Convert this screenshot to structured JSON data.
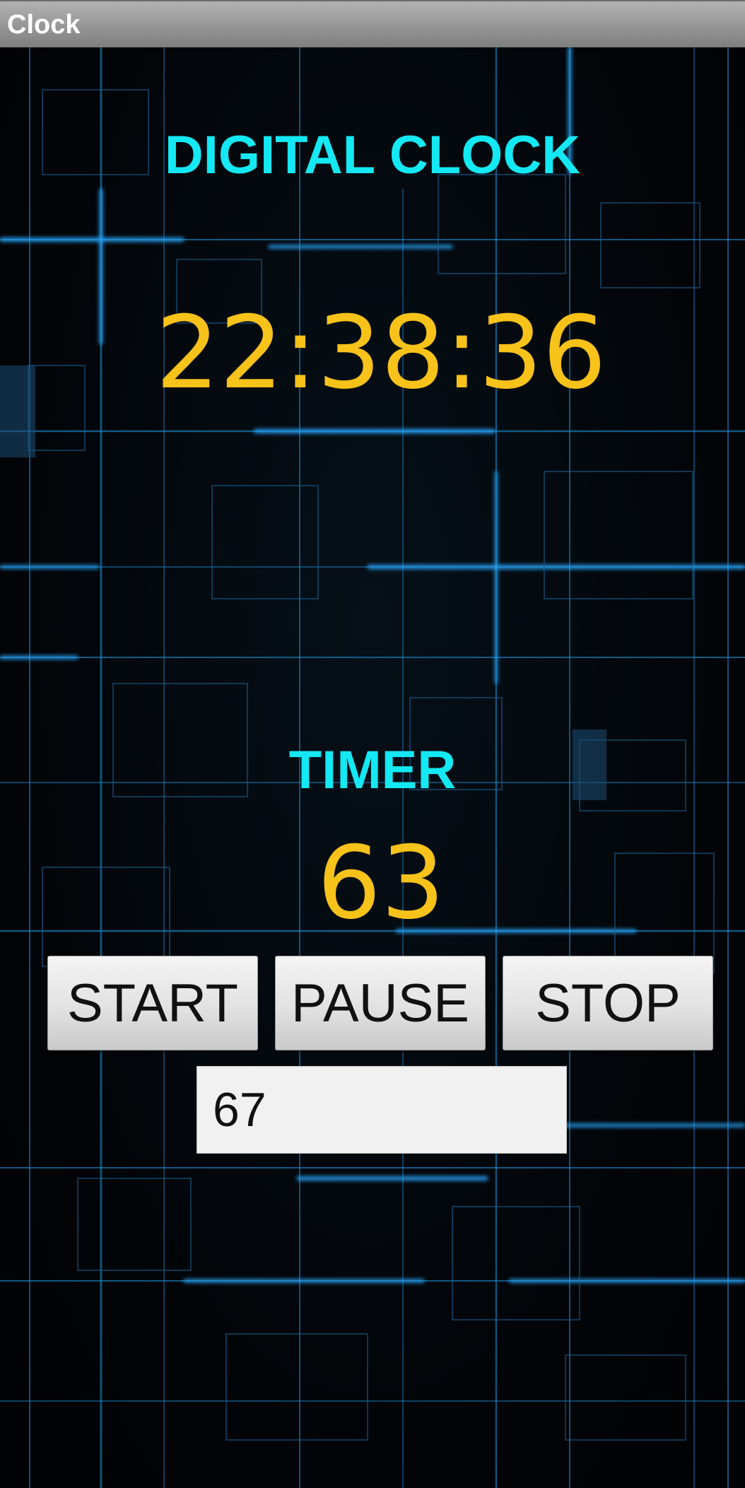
{
  "window": {
    "title": "Clock"
  },
  "clock": {
    "heading": "DIGITAL CLOCK",
    "time": "22:38:36"
  },
  "timer": {
    "heading": "TIMER",
    "value": "63",
    "start_label": "START",
    "pause_label": "PAUSE",
    "stop_label": "STOP",
    "input_value": "67"
  },
  "colors": {
    "heading": "#14e8f2",
    "digits": "#f7c21a",
    "background": "#020306",
    "grid_lines": "#1e90d6"
  }
}
